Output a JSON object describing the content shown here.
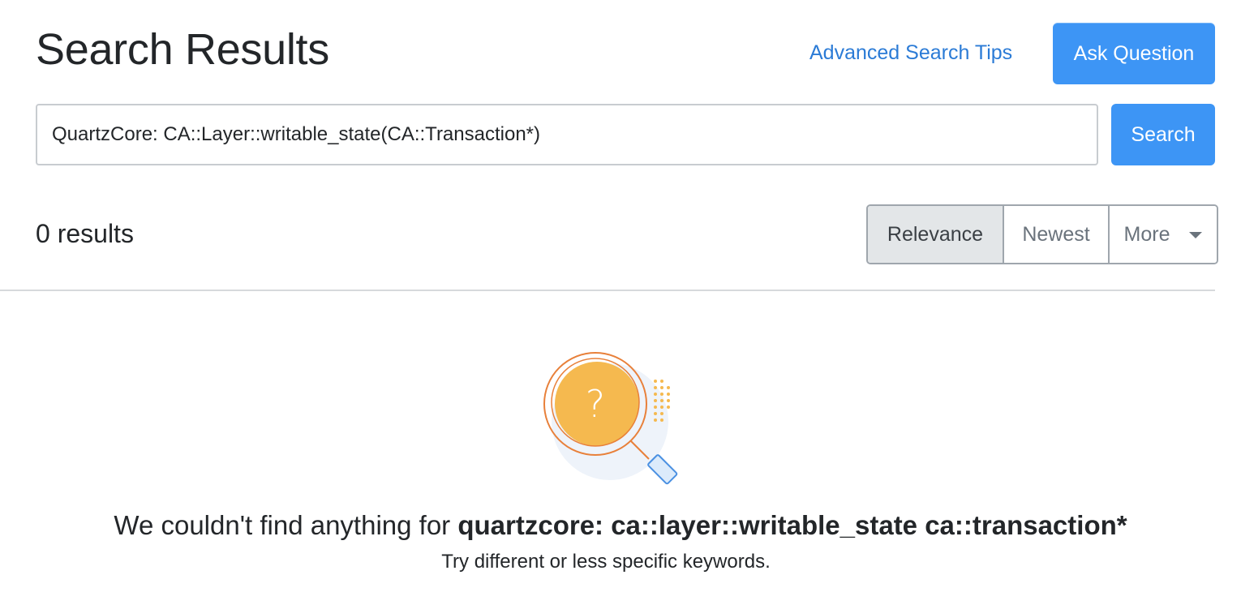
{
  "header": {
    "title": "Search Results",
    "tips_link": "Advanced Search Tips",
    "ask_button": "Ask Question"
  },
  "search": {
    "value": "QuartzCore: CA::Layer::writable_state(CA::Transaction*)",
    "button_label": "Search"
  },
  "results": {
    "count_text": "0 results"
  },
  "sort": {
    "options": [
      {
        "label": "Relevance",
        "active": true
      },
      {
        "label": "Newest",
        "active": false
      },
      {
        "label": "More",
        "active": false
      }
    ]
  },
  "empty_state": {
    "icon": "magnifier-question-icon",
    "icon_glyph": "?",
    "message_prefix": "We couldn't find anything for ",
    "query": "quartzcore: ca::layer::writable_state ca::transaction*",
    "hint": "Try different or less specific keywords."
  },
  "colors": {
    "primary": "#3d95f5",
    "link": "#2b7bd6",
    "illustration_orange": "#f5b94f",
    "illustration_stroke": "#e8803a",
    "illustration_blue": "#4a90e2"
  }
}
